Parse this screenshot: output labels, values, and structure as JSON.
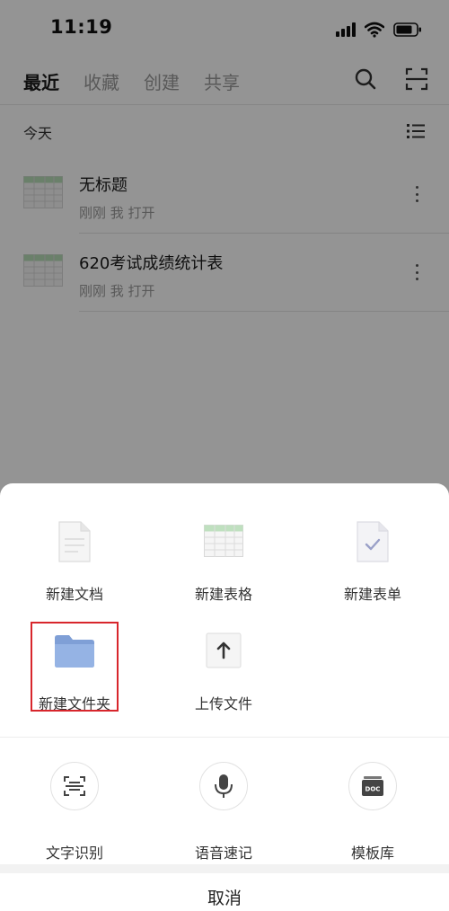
{
  "status_bar": {
    "time": "11:19"
  },
  "nav": {
    "tabs": [
      {
        "label": "最近",
        "active": true
      },
      {
        "label": "收藏",
        "active": false
      },
      {
        "label": "创建",
        "active": false
      },
      {
        "label": "共享",
        "active": false
      }
    ]
  },
  "section": {
    "title": "今天"
  },
  "files": [
    {
      "name": "无标题",
      "meta": "刚刚 我 打开"
    },
    {
      "name": "620考试成绩统计表",
      "meta": "刚刚 我 打开"
    }
  ],
  "sheet": {
    "create_items": [
      {
        "label": "新建文档",
        "icon": "document-icon"
      },
      {
        "label": "新建表格",
        "icon": "spreadsheet-icon"
      },
      {
        "label": "新建表单",
        "icon": "form-icon"
      },
      {
        "label": "新建文件夹",
        "icon": "folder-icon"
      },
      {
        "label": "上传文件",
        "icon": "upload-icon"
      }
    ],
    "tools": [
      {
        "label": "文字识别",
        "icon": "text-scan-icon"
      },
      {
        "label": "语音速记",
        "icon": "microphone-icon"
      },
      {
        "label": "模板库",
        "icon": "template-icon",
        "badge": "DOC"
      }
    ],
    "cancel": "取消"
  },
  "colors": {
    "highlight": "#d8262c",
    "folder": "#7f9fd6"
  }
}
